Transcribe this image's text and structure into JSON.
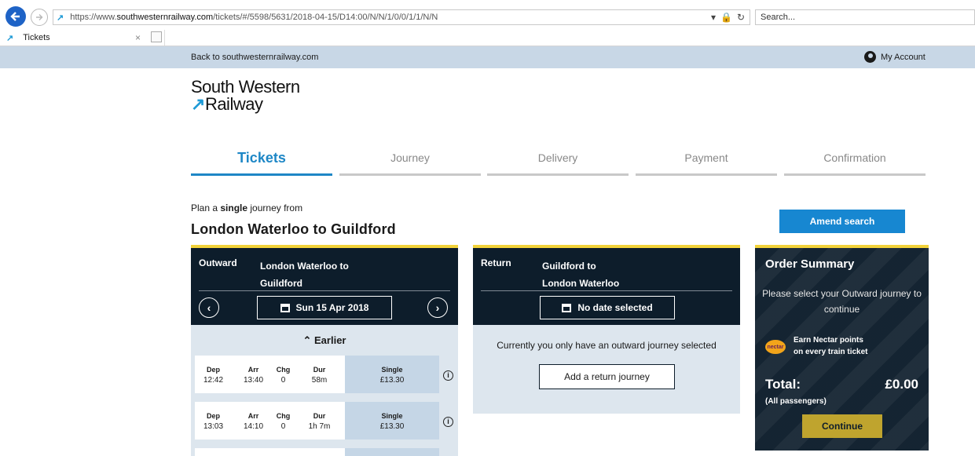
{
  "browser": {
    "url_prefix": "https://www.",
    "url_domain": "southwesternrailway.com",
    "url_path": "/tickets/#/5598/5631/2018-04-15/D14:00/N/N/1/0/0/1/1/N/N",
    "search_placeholder": "Search...",
    "tab_title": "Tickets",
    "tab_close": "×"
  },
  "header": {
    "back_link": "Back to southwesternrailway.com",
    "my_account": "My Account",
    "logo_line1": "South Western",
    "logo_arrow": "↗",
    "logo_line2": "Railway"
  },
  "steps": [
    {
      "label": "Tickets"
    },
    {
      "label": "Journey"
    },
    {
      "label": "Delivery"
    },
    {
      "label": "Payment"
    },
    {
      "label": "Confirmation"
    }
  ],
  "plan": {
    "prefix": "Plan a ",
    "type": "single",
    "suffix": " journey from",
    "route": "London Waterloo to Guildford"
  },
  "amend_label": "Amend search",
  "outward": {
    "label": "Outward",
    "route_line1": "London Waterloo to",
    "route_line2": "Guildford",
    "date": "Sun 15 Apr 2018",
    "earlier": "Earlier",
    "columns": {
      "dep": "Dep",
      "arr": "Arr",
      "chg": "Chg",
      "dur": "Dur",
      "fare": "Single"
    },
    "rows": [
      {
        "dep": "12:42",
        "arr": "13:40",
        "chg": "0",
        "dur": "58m",
        "fare": "£13.30"
      },
      {
        "dep": "13:03",
        "arr": "14:10",
        "chg": "0",
        "dur": "1h 7m",
        "fare": "£13.30"
      }
    ]
  },
  "return": {
    "label": "Return",
    "route_line1": "Guildford to",
    "route_line2": "London Waterloo",
    "date": "No date selected",
    "message": "Currently you only have an outward journey selected",
    "add_label": "Add a return journey"
  },
  "summary": {
    "title": "Order Summary",
    "message": "Please select your Outward journey to continue",
    "nectar_badge": "nectar",
    "nectar_line1": "Earn Nectar points",
    "nectar_line2": "on every train ticket",
    "total_label": "Total:",
    "total_value": "£0.00",
    "passengers": "(All passengers)",
    "continue_label": "Continue"
  },
  "colors": {
    "accent_blue": "#1787d1",
    "dark_navy": "#0d1d2b",
    "yellow": "#f2d23a",
    "gold_button": "#bfa42e"
  }
}
